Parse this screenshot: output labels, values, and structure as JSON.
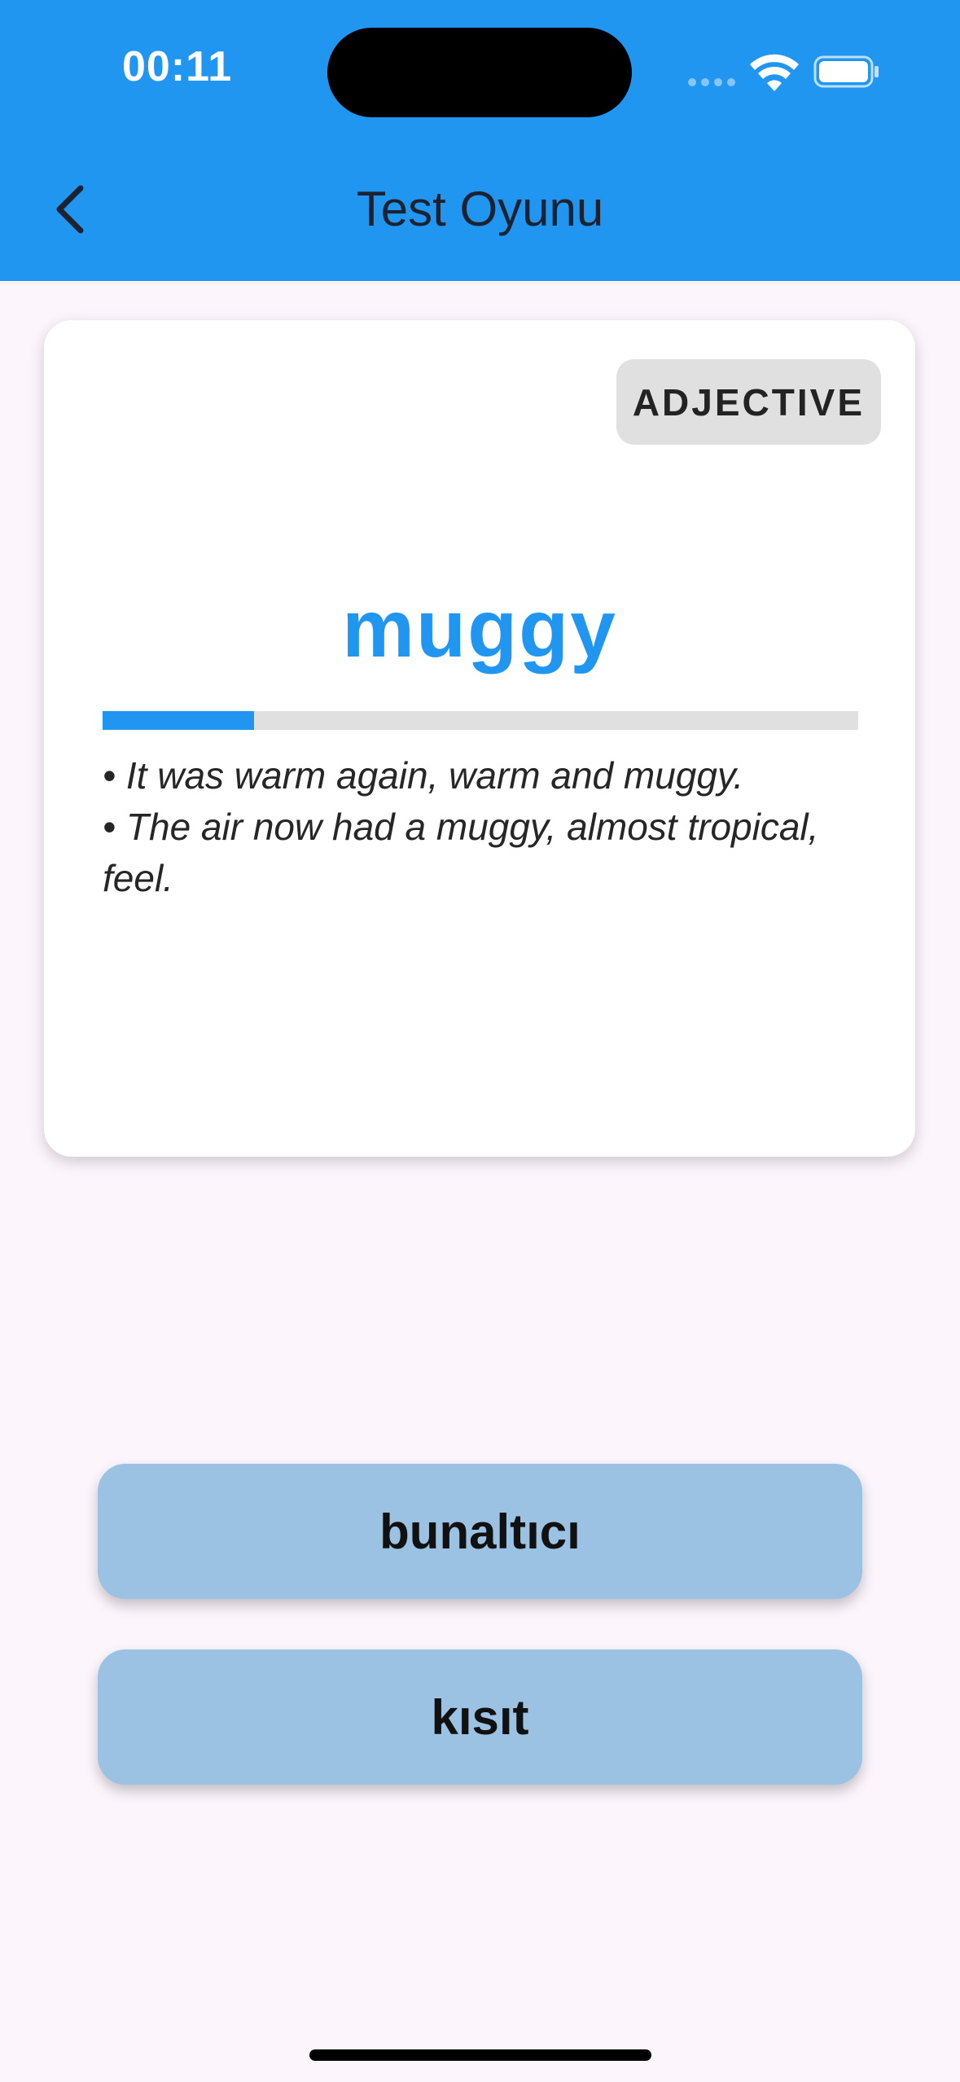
{
  "status_bar": {
    "time": "00:11"
  },
  "header": {
    "title": "Test Oyunu",
    "back_icon": "chevron-left-icon"
  },
  "card": {
    "part_of_speech": "ADJECTIVE",
    "word": "muggy",
    "progress_fraction": 0.2,
    "examples": [
      "• It was warm again, warm and muggy.",
      "• The air now had a muggy, almost tropical, feel."
    ]
  },
  "options": [
    {
      "label": "bunaltıcı"
    },
    {
      "label": "kısıt"
    }
  ],
  "colors": {
    "primary": "#2196f0",
    "option_bg": "#9bc2e2",
    "background": "#fcf5fc"
  }
}
